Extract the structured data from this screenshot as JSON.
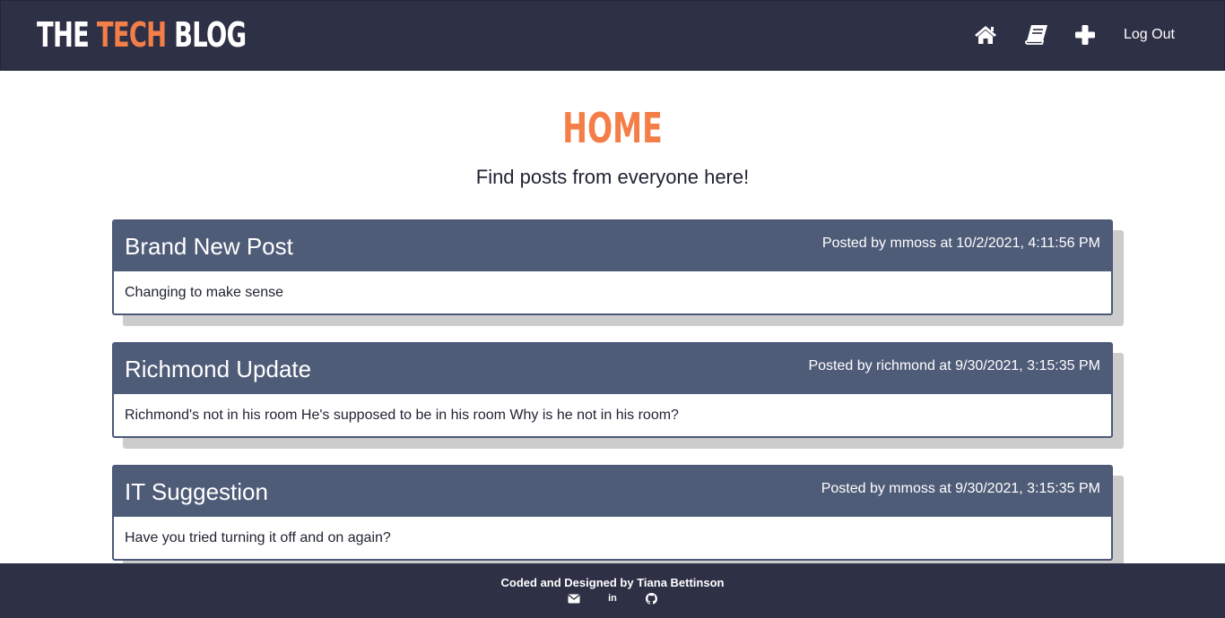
{
  "header": {
    "brand": {
      "part1": "THE ",
      "accent": "TECH",
      "part2": " BLOG"
    },
    "nav": {
      "home_icon": "home-icon",
      "dashboard_icon": "book-icon",
      "new_post_icon": "plus-icon",
      "logout_label": "Log Out"
    }
  },
  "hero": {
    "title": "HOME",
    "subtitle": "Find posts from everyone here!"
  },
  "posts": [
    {
      "title": "Brand New Post",
      "meta": "Posted by mmoss at 10/2/2021, 4:11:56 PM",
      "body": "Changing to make sense"
    },
    {
      "title": "Richmond Update",
      "meta": "Posted by richmond at 9/30/2021, 3:15:35 PM",
      "body": "Richmond's not in his room He's supposed to be in his room Why is he not in his room?"
    },
    {
      "title": "IT Suggestion",
      "meta": "Posted by mmoss at 9/30/2021, 3:15:35 PM",
      "body": "Have you tried turning it off and on again?"
    }
  ],
  "footer": {
    "credit": "Coded and Designed by Tiana Bettinson",
    "links": [
      {
        "icon": "envelope-icon"
      },
      {
        "icon": "linkedin-icon",
        "text": "in"
      },
      {
        "icon": "github-icon"
      }
    ]
  },
  "colors": {
    "header_bg": "#2e3046",
    "accent": "#f47e48",
    "card_header": "#4f5c78"
  }
}
